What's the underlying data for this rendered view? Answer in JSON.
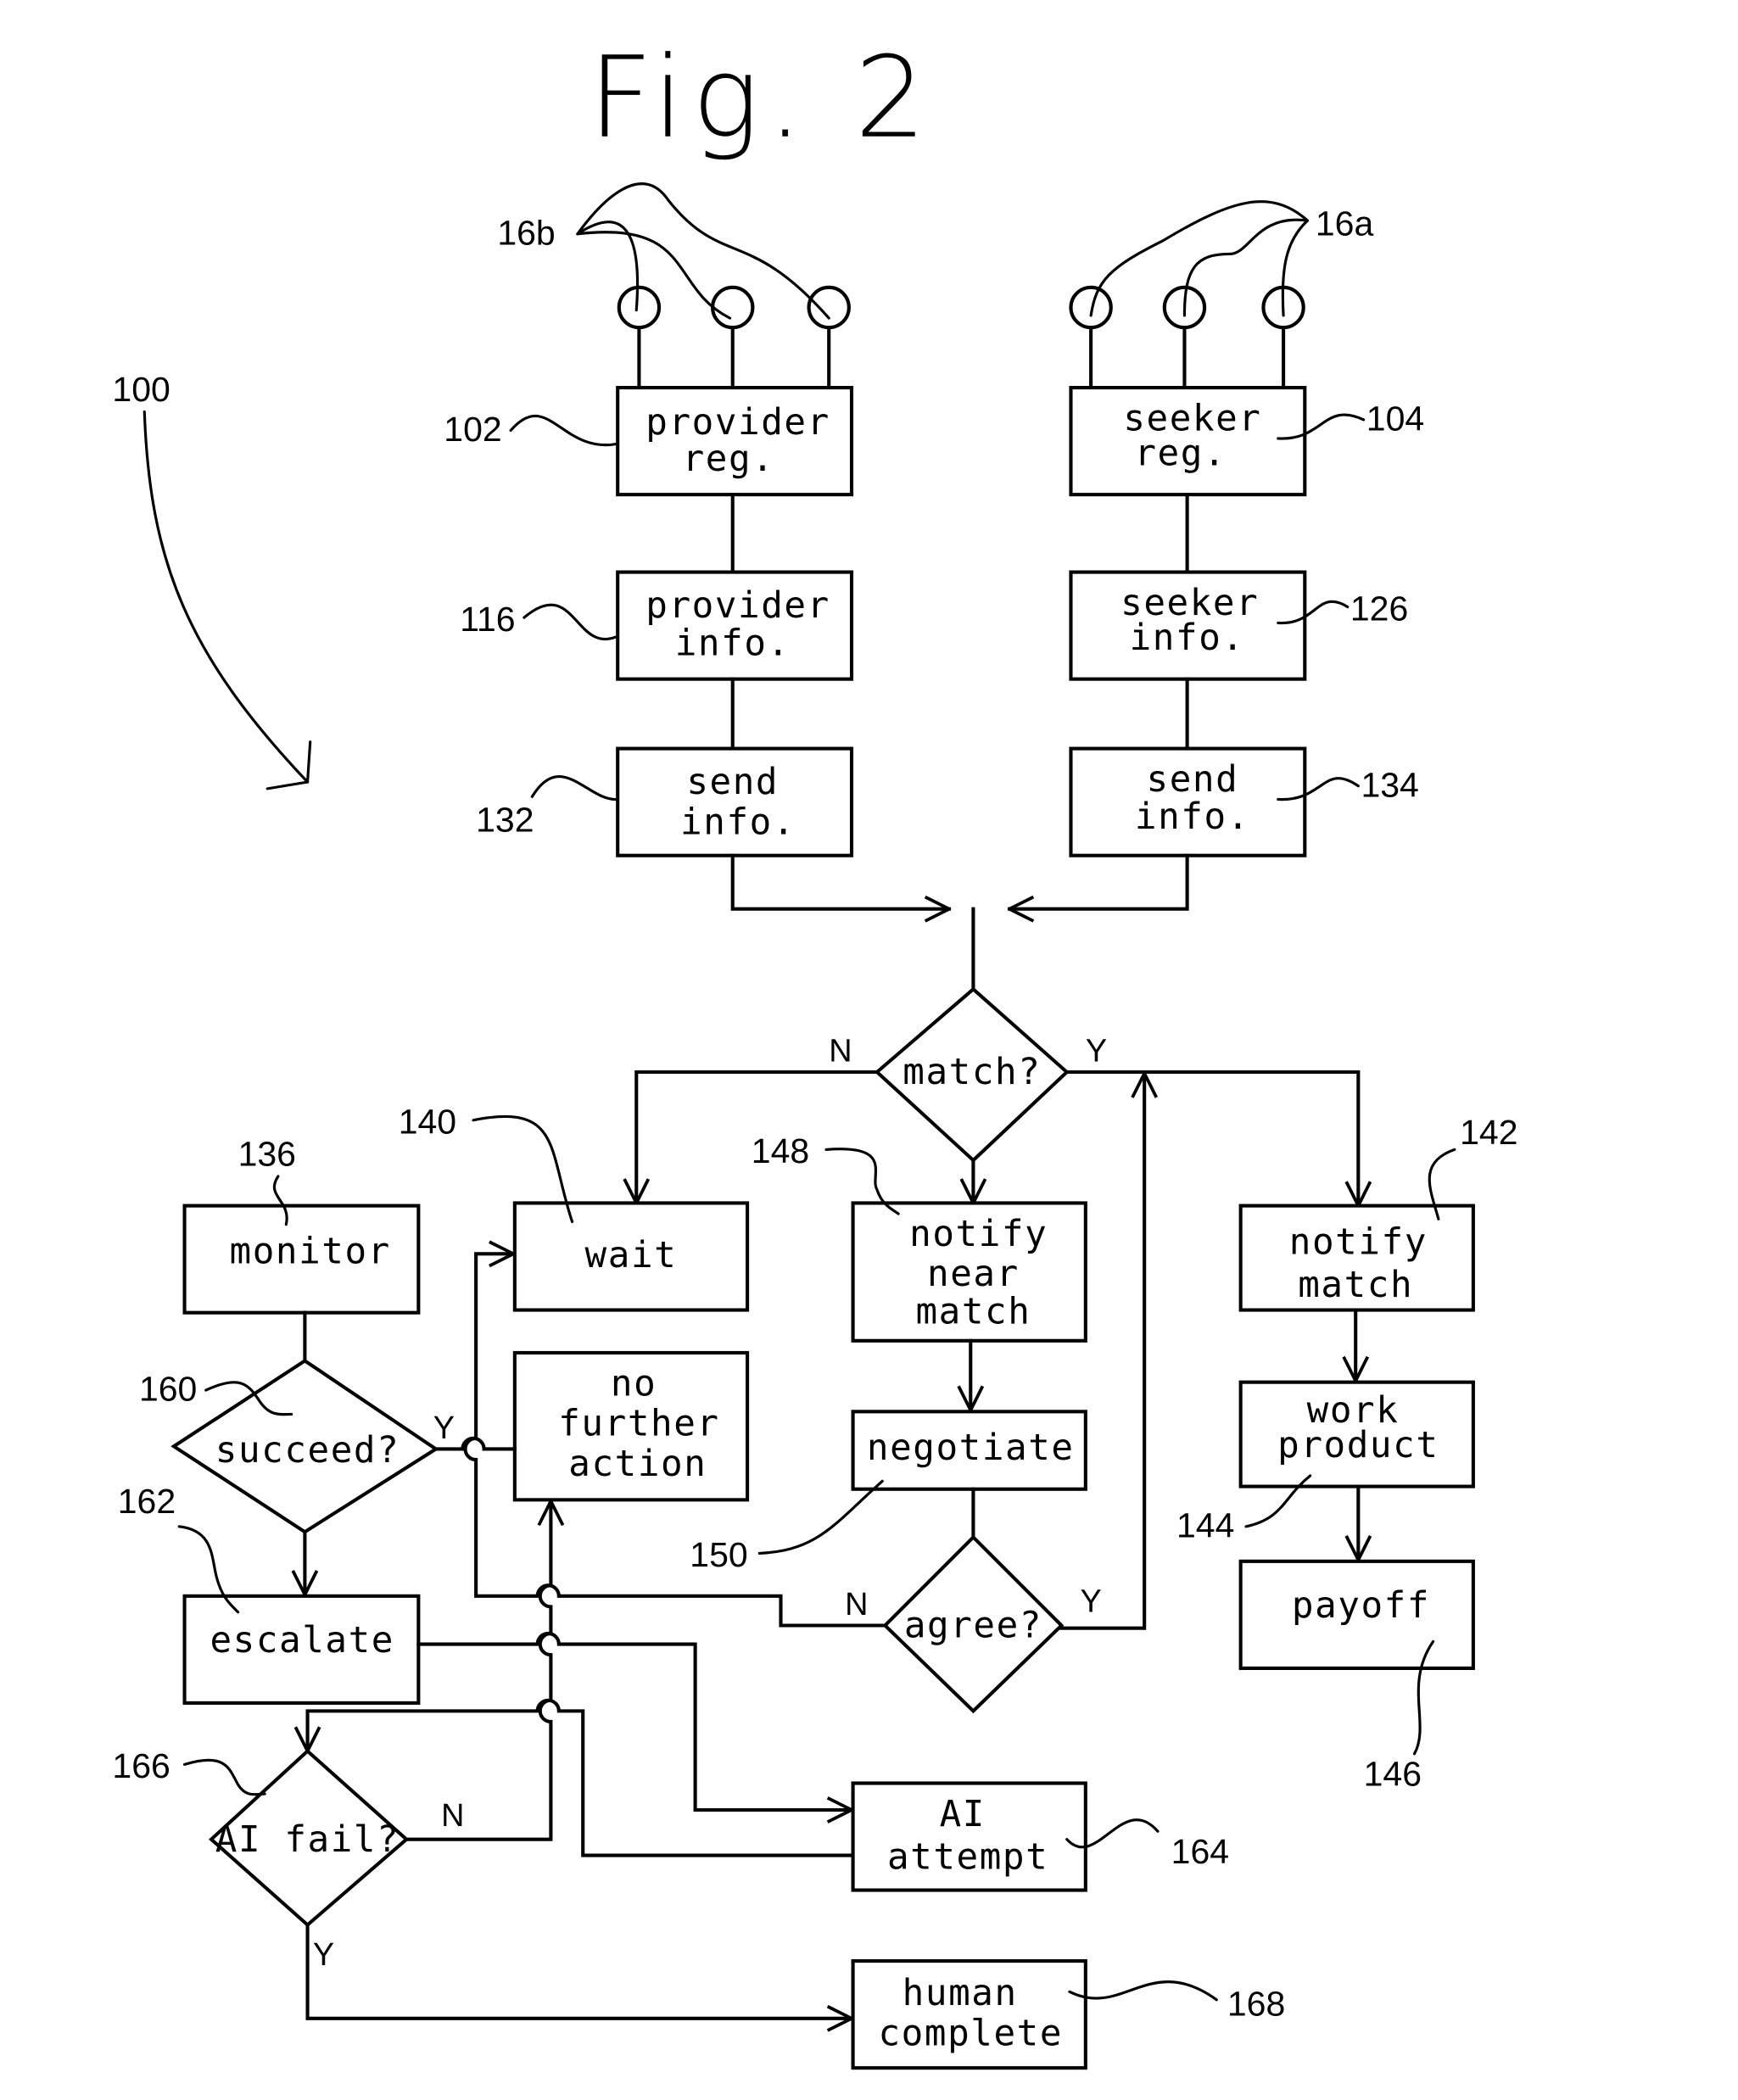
{
  "figure": {
    "title": "Fig. 2",
    "ref": "100"
  },
  "users": {
    "providers_ref": "16b",
    "seekers_ref": "16a"
  },
  "nodes": {
    "provider_reg": {
      "lines": [
        "provider",
        "reg."
      ],
      "ref": "102"
    },
    "seeker_reg": {
      "lines": [
        "seeker",
        "reg."
      ],
      "ref": "104"
    },
    "provider_info": {
      "lines": [
        "provider",
        "info."
      ],
      "ref": "116"
    },
    "seeker_info": {
      "lines": [
        "seeker",
        "info."
      ],
      "ref": "126"
    },
    "provider_send": {
      "lines": [
        "send",
        "info."
      ],
      "ref": "132"
    },
    "seeker_send": {
      "lines": [
        "send",
        "info."
      ],
      "ref": "134"
    },
    "match": {
      "label": "match?",
      "no": "N",
      "yes": "Y"
    },
    "monitor": {
      "label": "monitor",
      "ref": "136"
    },
    "wait": {
      "label": "wait",
      "ref": "140"
    },
    "notify_near_match": {
      "lines": [
        "notify",
        "near",
        "match"
      ],
      "ref": "148"
    },
    "notify_match": {
      "lines": [
        "notify",
        "match"
      ],
      "ref": "142"
    },
    "succeed": {
      "label": "succeed?",
      "yes": "Y",
      "ref": "160"
    },
    "no_further_action": {
      "lines": [
        "no",
        "further",
        "action"
      ]
    },
    "negotiate": {
      "label": "negotiate",
      "ref": "150"
    },
    "work_product": {
      "lines": [
        "work",
        "product"
      ],
      "ref": "144"
    },
    "escalate": {
      "label": "escalate",
      "ref": "162"
    },
    "agree": {
      "label": "agree?",
      "no": "N",
      "yes": "Y"
    },
    "payoff": {
      "label": "payoff",
      "ref": "146"
    },
    "ai_fail": {
      "label": "AI fail?",
      "no": "N",
      "yes": "Y",
      "ref": "166"
    },
    "ai_attempt": {
      "lines": [
        "AI",
        "attempt"
      ],
      "ref": "164"
    },
    "human_complete": {
      "lines": [
        "human",
        "complete"
      ],
      "ref": "168"
    }
  }
}
